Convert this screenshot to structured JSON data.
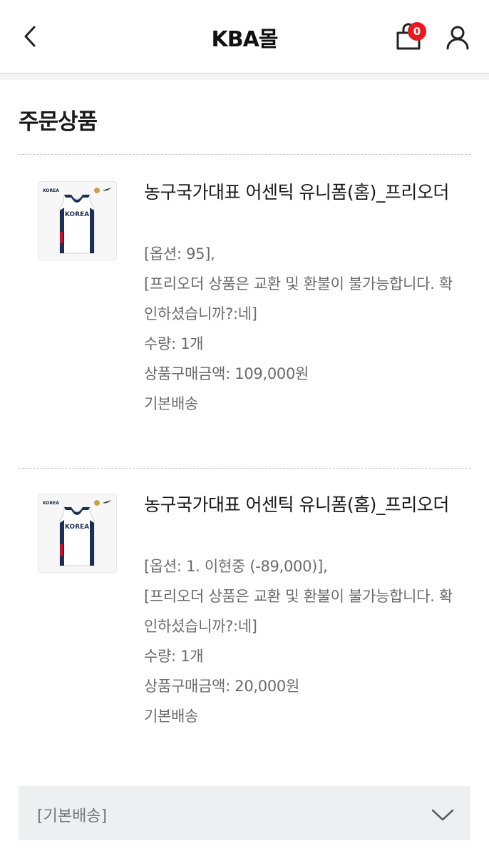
{
  "header": {
    "title": "KBA몰",
    "cart_count": "0"
  },
  "section": {
    "title": "주문상품"
  },
  "products": [
    {
      "name": "농구국가대표 어센틱 유니폼(홈)_프리오더",
      "option": "[옵션: 95],",
      "notice": "[프리오더 상품은 교환 및 환불이 불가능합니다. 확인하셨습니까?:네]",
      "quantity": "수량: 1개",
      "price": "상품구매금액: 109,000원",
      "shipping": "기본배송",
      "thumb_brand": "KOREA",
      "thumb_jersey": "KOREA"
    },
    {
      "name": "농구국가대표 어센틱 유니폼(홈)_프리오더",
      "option": "[옵션: 1. 이현중 (-89,000)],",
      "notice": "[프리오더 상품은 교환 및 환불이 불가능합니다. 확인하셨습니까?:네]",
      "quantity": "수량: 1개",
      "price": "상품구매금액: 20,000원",
      "shipping": "기본배송",
      "thumb_brand": "KOREA",
      "thumb_jersey": "KOREA"
    }
  ],
  "delivery": {
    "label": "[기본배송]"
  },
  "colors": {
    "badge": "#e8191e",
    "delivery_bg": "#edeff1",
    "muted_text": "#6b6b6b"
  }
}
